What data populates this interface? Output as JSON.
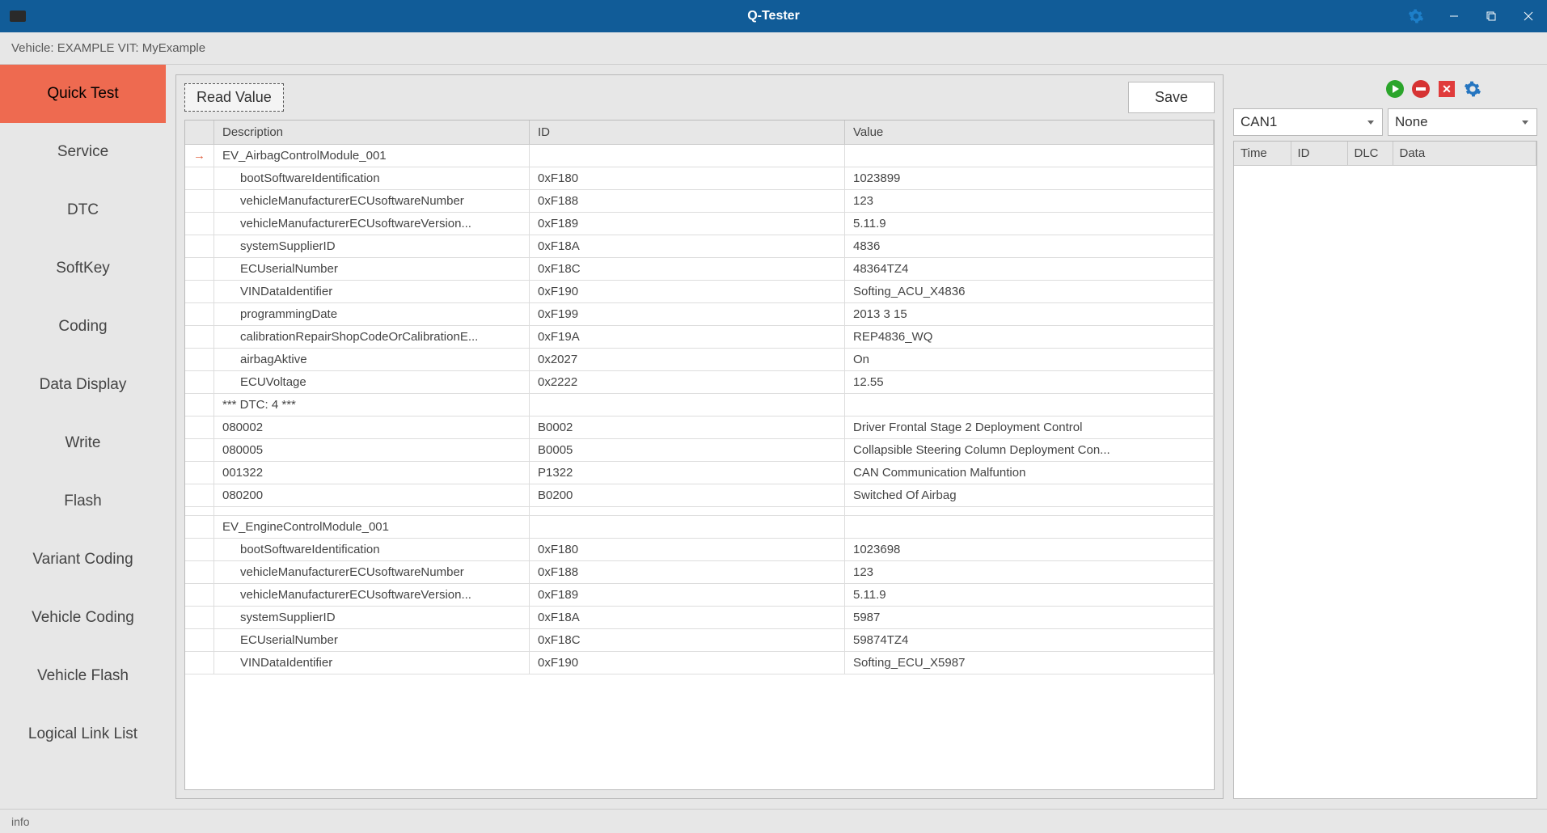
{
  "titlebar": {
    "title": "Q-Tester"
  },
  "vehicle_bar": "Vehicle:  EXAMPLE VIT:  MyExample",
  "sidebar": {
    "items": [
      {
        "label": "Quick Test",
        "active": true
      },
      {
        "label": "Service"
      },
      {
        "label": "DTC"
      },
      {
        "label": "SoftKey"
      },
      {
        "label": "Coding"
      },
      {
        "label": "Data Display"
      },
      {
        "label": "Write"
      },
      {
        "label": "Flash"
      },
      {
        "label": "Variant Coding"
      },
      {
        "label": "Vehicle Coding"
      },
      {
        "label": "Vehicle Flash"
      },
      {
        "label": "Logical Link List"
      }
    ]
  },
  "main": {
    "read_value": "Read Value",
    "save": "Save",
    "columns": {
      "desc": "Description",
      "id": "ID",
      "value": "Value"
    },
    "rows": [
      {
        "marker": "→",
        "desc": "EV_AirbagControlModule_001",
        "id": "",
        "value": "",
        "group": true
      },
      {
        "desc": "bootSoftwareIdentification",
        "id": "0xF180",
        "value": "1023899",
        "indent": true
      },
      {
        "desc": "vehicleManufacturerECUsoftwareNumber",
        "id": "0xF188",
        "value": "123",
        "indent": true
      },
      {
        "desc": "vehicleManufacturerECUsoftwareVersion...",
        "id": "0xF189",
        "value": "5.11.9",
        "indent": true
      },
      {
        "desc": "systemSupplierID",
        "id": "0xF18A",
        "value": "4836",
        "indent": true
      },
      {
        "desc": "ECUserialNumber",
        "id": "0xF18C",
        "value": "48364TZ4",
        "indent": true
      },
      {
        "desc": "VINDataIdentifier",
        "id": "0xF190",
        "value": "Softing_ACU_X4836",
        "indent": true
      },
      {
        "desc": "programmingDate",
        "id": "0xF199",
        "value": "2013 3 15",
        "indent": true
      },
      {
        "desc": "calibrationRepairShopCodeOrCalibrationE...",
        "id": "0xF19A",
        "value": "REP4836_WQ",
        "indent": true
      },
      {
        "desc": "airbagAktive",
        "id": "0x2027",
        "value": "On",
        "indent": true
      },
      {
        "desc": "ECUVoltage",
        "id": "0x2222",
        "value": "12.55",
        "indent": true
      },
      {
        "desc": "*** DTC: 4 ***",
        "id": "",
        "value": "",
        "group": true
      },
      {
        "desc": "080002",
        "id": "B0002",
        "value": "Driver Frontal Stage 2 Deployment Control"
      },
      {
        "desc": "080005",
        "id": "B0005",
        "value": "Collapsible Steering Column Deployment Con..."
      },
      {
        "desc": "001322",
        "id": "P1322",
        "value": "CAN Communication Malfuntion"
      },
      {
        "desc": "080200",
        "id": "B0200",
        "value": "Switched Of Airbag"
      },
      {
        "desc": "",
        "id": "",
        "value": "",
        "group": true
      },
      {
        "desc": "EV_EngineControlModule_001",
        "id": "",
        "value": "",
        "group": true
      },
      {
        "desc": "bootSoftwareIdentification",
        "id": "0xF180",
        "value": "1023698",
        "indent": true
      },
      {
        "desc": "vehicleManufacturerECUsoftwareNumber",
        "id": "0xF188",
        "value": "123",
        "indent": true
      },
      {
        "desc": "vehicleManufacturerECUsoftwareVersion...",
        "id": "0xF189",
        "value": "5.11.9",
        "indent": true
      },
      {
        "desc": "systemSupplierID",
        "id": "0xF18A",
        "value": "5987",
        "indent": true
      },
      {
        "desc": "ECUserialNumber",
        "id": "0xF18C",
        "value": "59874TZ4",
        "indent": true
      },
      {
        "desc": "VINDataIdentifier",
        "id": "0xF190",
        "value": "Softing_ECU_X5987",
        "indent": true
      }
    ]
  },
  "right": {
    "can_select": "CAN1",
    "none_select": "None",
    "columns": {
      "time": "Time",
      "id": "ID",
      "dlc": "DLC",
      "data": "Data"
    }
  },
  "statusbar": {
    "text": "info"
  }
}
